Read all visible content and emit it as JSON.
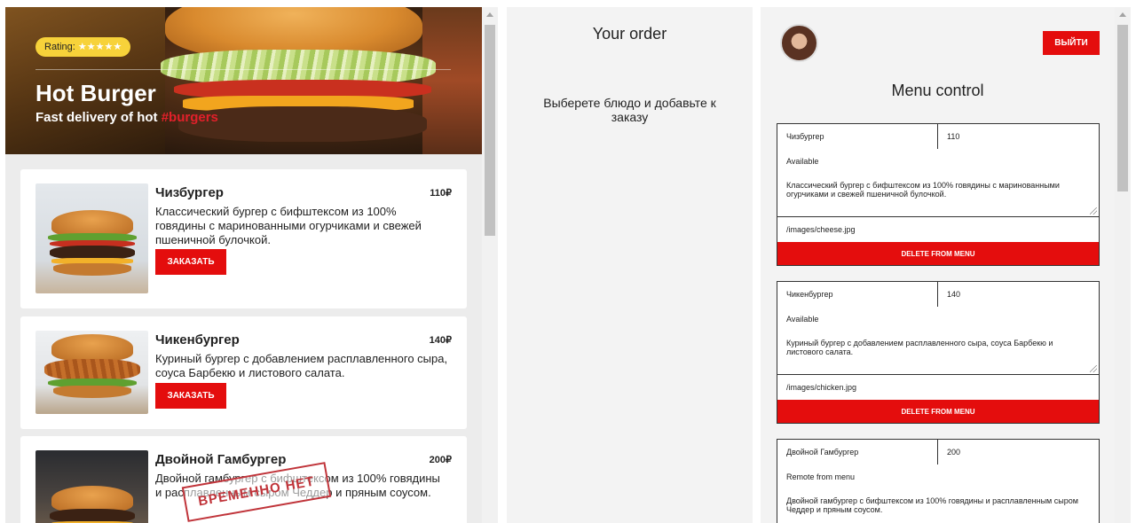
{
  "header": {
    "rating_label": "Rating:",
    "rating_stars": "★★★★★",
    "title": "Hot Burger",
    "subtitle_prefix": "Fast delivery of hot ",
    "subtitle_accent": "#burgers"
  },
  "menu": {
    "items": [
      {
        "name": "Чизбургер",
        "price": "110₽",
        "desc": "Классический бургер с бифштексом из 100% говядины с маринованными огурчиками и свежей пшеничной булочкой.",
        "button": "ЗАКАЗАТЬ"
      },
      {
        "name": "Чикенбургер",
        "price": "140₽",
        "desc": "Куриный бургер с добавлением расплавленного сыра, соуса Барбекю и листового салата.",
        "button": "ЗАКАЗАТЬ"
      },
      {
        "name": "Двойной Гамбургер",
        "price": "200₽",
        "desc": "Двойной гамбургер с бифштексом из 100% говядины и расплавленным сыром Чеддер и пряным соусом.",
        "stamp": "ВРЕМЕННО НЕТ"
      }
    ]
  },
  "order": {
    "title": "Your order",
    "empty_text": "Выберете блюдо и добавьте к заказу"
  },
  "admin": {
    "logout_label": "ВЫЙТИ",
    "title": "Menu control",
    "forms": [
      {
        "name": "Чизбургер",
        "price": "110",
        "status": "Available",
        "desc": "Классический бургер с бифштексом из 100% говядины с маринованными огурчиками и свежей пшеничной булочкой.",
        "image": "/images/cheese.jpg",
        "delete_label": "DELETE FROM MENU"
      },
      {
        "name": "Чикенбургер",
        "price": "140",
        "status": "Available",
        "desc": "Куриный бургер с добавлением расплавленного сыра, соуса Барбекю и листового салата.",
        "image": "/images/chicken.jpg",
        "delete_label": "DELETE FROM MENU"
      },
      {
        "name": "Двойной Гамбургер",
        "price": "200",
        "status": "Remote from menu",
        "desc": "Двойной гамбургер с бифштексом из 100% говядины и расплавленным сыром Чеддер и пряным соусом."
      }
    ]
  },
  "colors": {
    "accent": "#e40d0d",
    "rating_bg": "#f7d23a",
    "stamp": "#c0343a",
    "panel_bg": "#f3f3f3"
  }
}
